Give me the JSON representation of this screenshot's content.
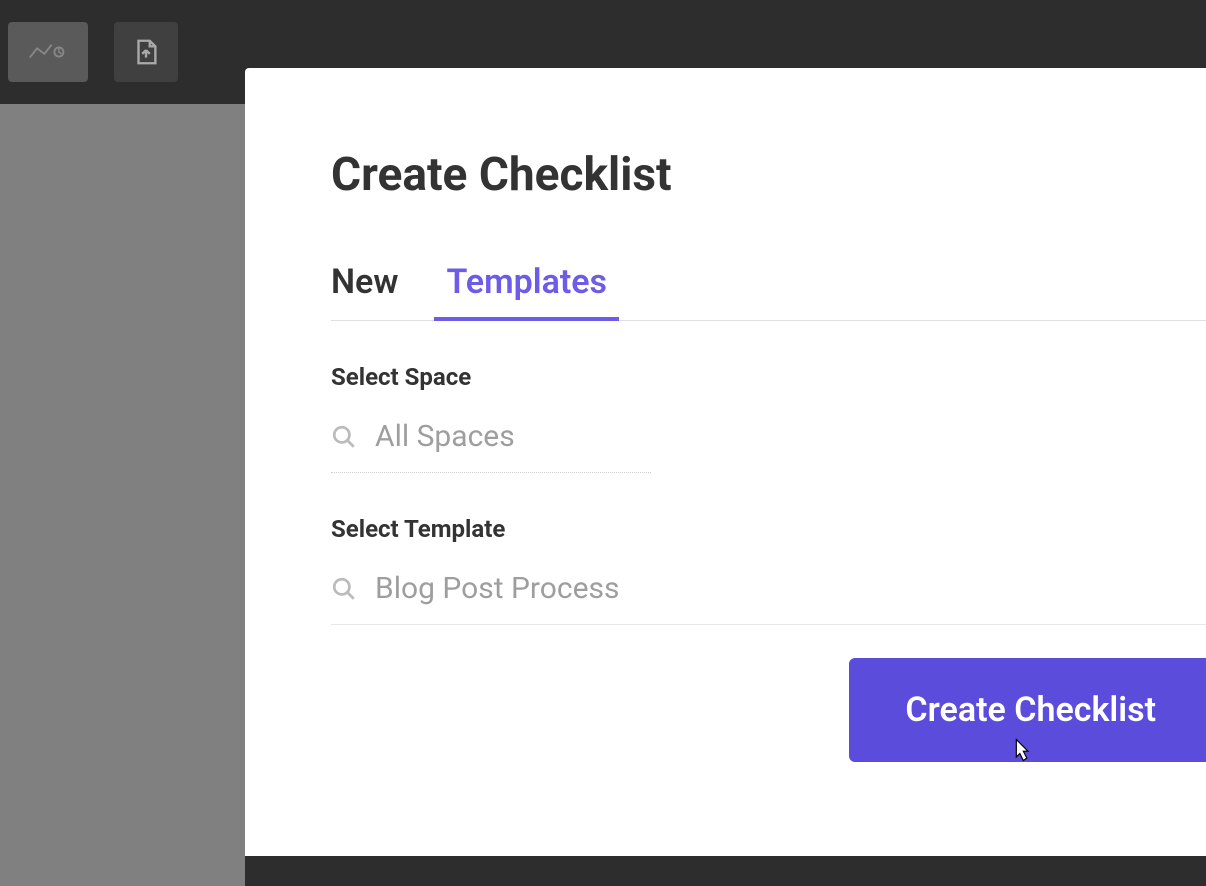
{
  "modal": {
    "title": "Create Checklist",
    "tabs": {
      "new": "New",
      "templates": "Templates"
    },
    "sections": {
      "space": {
        "label": "Select Space",
        "value": "All Spaces"
      },
      "template": {
        "label": "Select Template",
        "value": "Blog Post Process"
      }
    },
    "create_button": "Create Checklist"
  },
  "icons": {
    "search": "search-icon",
    "cursor": "pointer-cursor",
    "toolbar1": "chart-icon",
    "toolbar2": "export-icon"
  }
}
